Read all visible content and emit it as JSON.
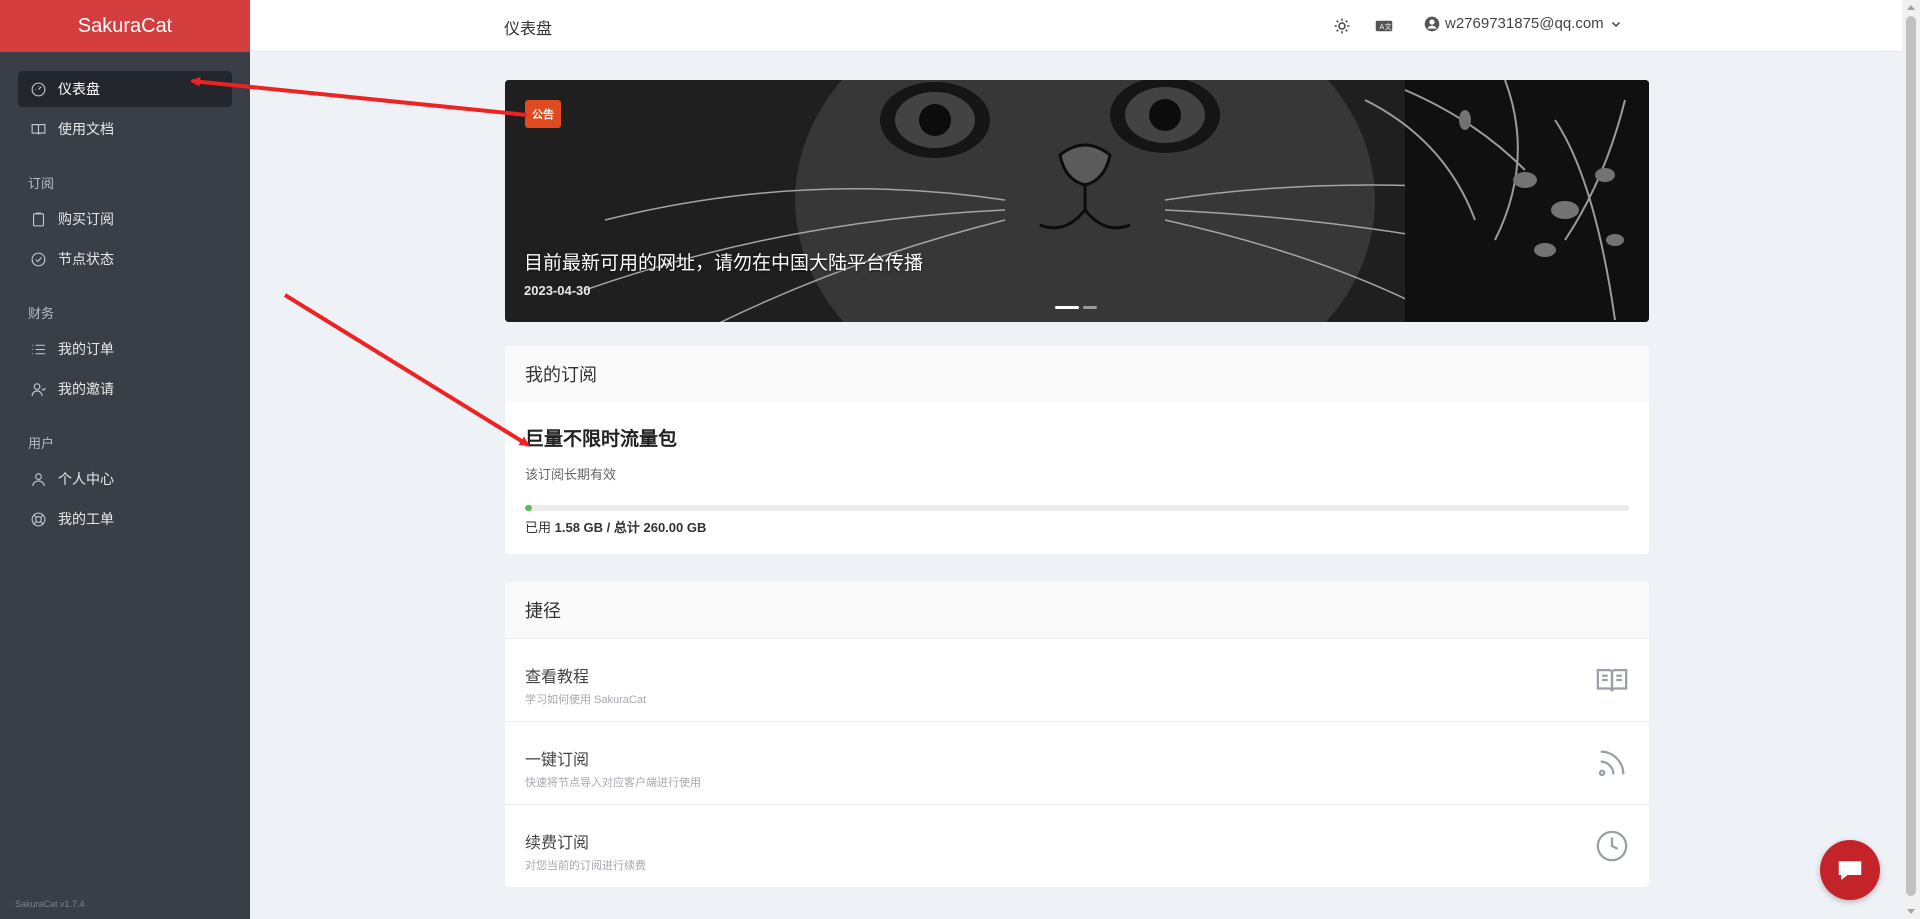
{
  "sidebar": {
    "brand": "SakuraCat",
    "items": [
      {
        "label": "仪表盘",
        "icon": "dashboard-icon",
        "active": true
      },
      {
        "label": "使用文档",
        "icon": "book-icon"
      }
    ],
    "sections": [
      {
        "title": "订阅",
        "items": [
          {
            "label": "购买订阅",
            "icon": "clipboard-icon"
          },
          {
            "label": "节点状态",
            "icon": "check-circle-icon"
          }
        ]
      },
      {
        "title": "财务",
        "items": [
          {
            "label": "我的订单",
            "icon": "list-icon"
          },
          {
            "label": "我的邀请",
            "icon": "users-icon"
          }
        ]
      },
      {
        "title": "用户",
        "items": [
          {
            "label": "个人中心",
            "icon": "user-icon"
          },
          {
            "label": "我的工单",
            "icon": "lifebuoy-icon"
          }
        ]
      }
    ],
    "version": "SakuraCat v1.7.4"
  },
  "header": {
    "title": "仪表盘",
    "theme_icon": "sun-icon",
    "lang_icon": "translate-icon",
    "user_email": "w2769731875@qq.com"
  },
  "banner": {
    "badge": "公告",
    "title": "目前最新可用的网址，请勿在中国大陆平台传播",
    "date": "2023-04-30"
  },
  "subscription": {
    "header": "我的订阅",
    "plan": "巨量不限时流量包",
    "desc": "该订阅长期有效",
    "used_fraction": 0.006,
    "usage_prefix": "已用 ",
    "usage_value": "1.58 GB / 总计 260.00 GB"
  },
  "shortcuts": {
    "header": "捷径",
    "items": [
      {
        "title": "查看教程",
        "desc": "学习如何使用 SakuraCat",
        "icon": "book-open-icon"
      },
      {
        "title": "一键订阅",
        "desc": "快速将节点导入对应客户端进行使用",
        "icon": "rss-icon"
      },
      {
        "title": "续费订阅",
        "desc": "对您当前的订阅进行续费",
        "icon": "clock-icon"
      }
    ]
  },
  "colors": {
    "brand_red": "#d33d3d",
    "sidebar_bg": "#3a3f47",
    "badge_orange": "#e04a1f",
    "progress_green": "#5cb85c",
    "chat_red": "#c4232a",
    "arrow_red": "#ee2222"
  },
  "chat": {
    "icon": "chat-bubble-icon"
  }
}
